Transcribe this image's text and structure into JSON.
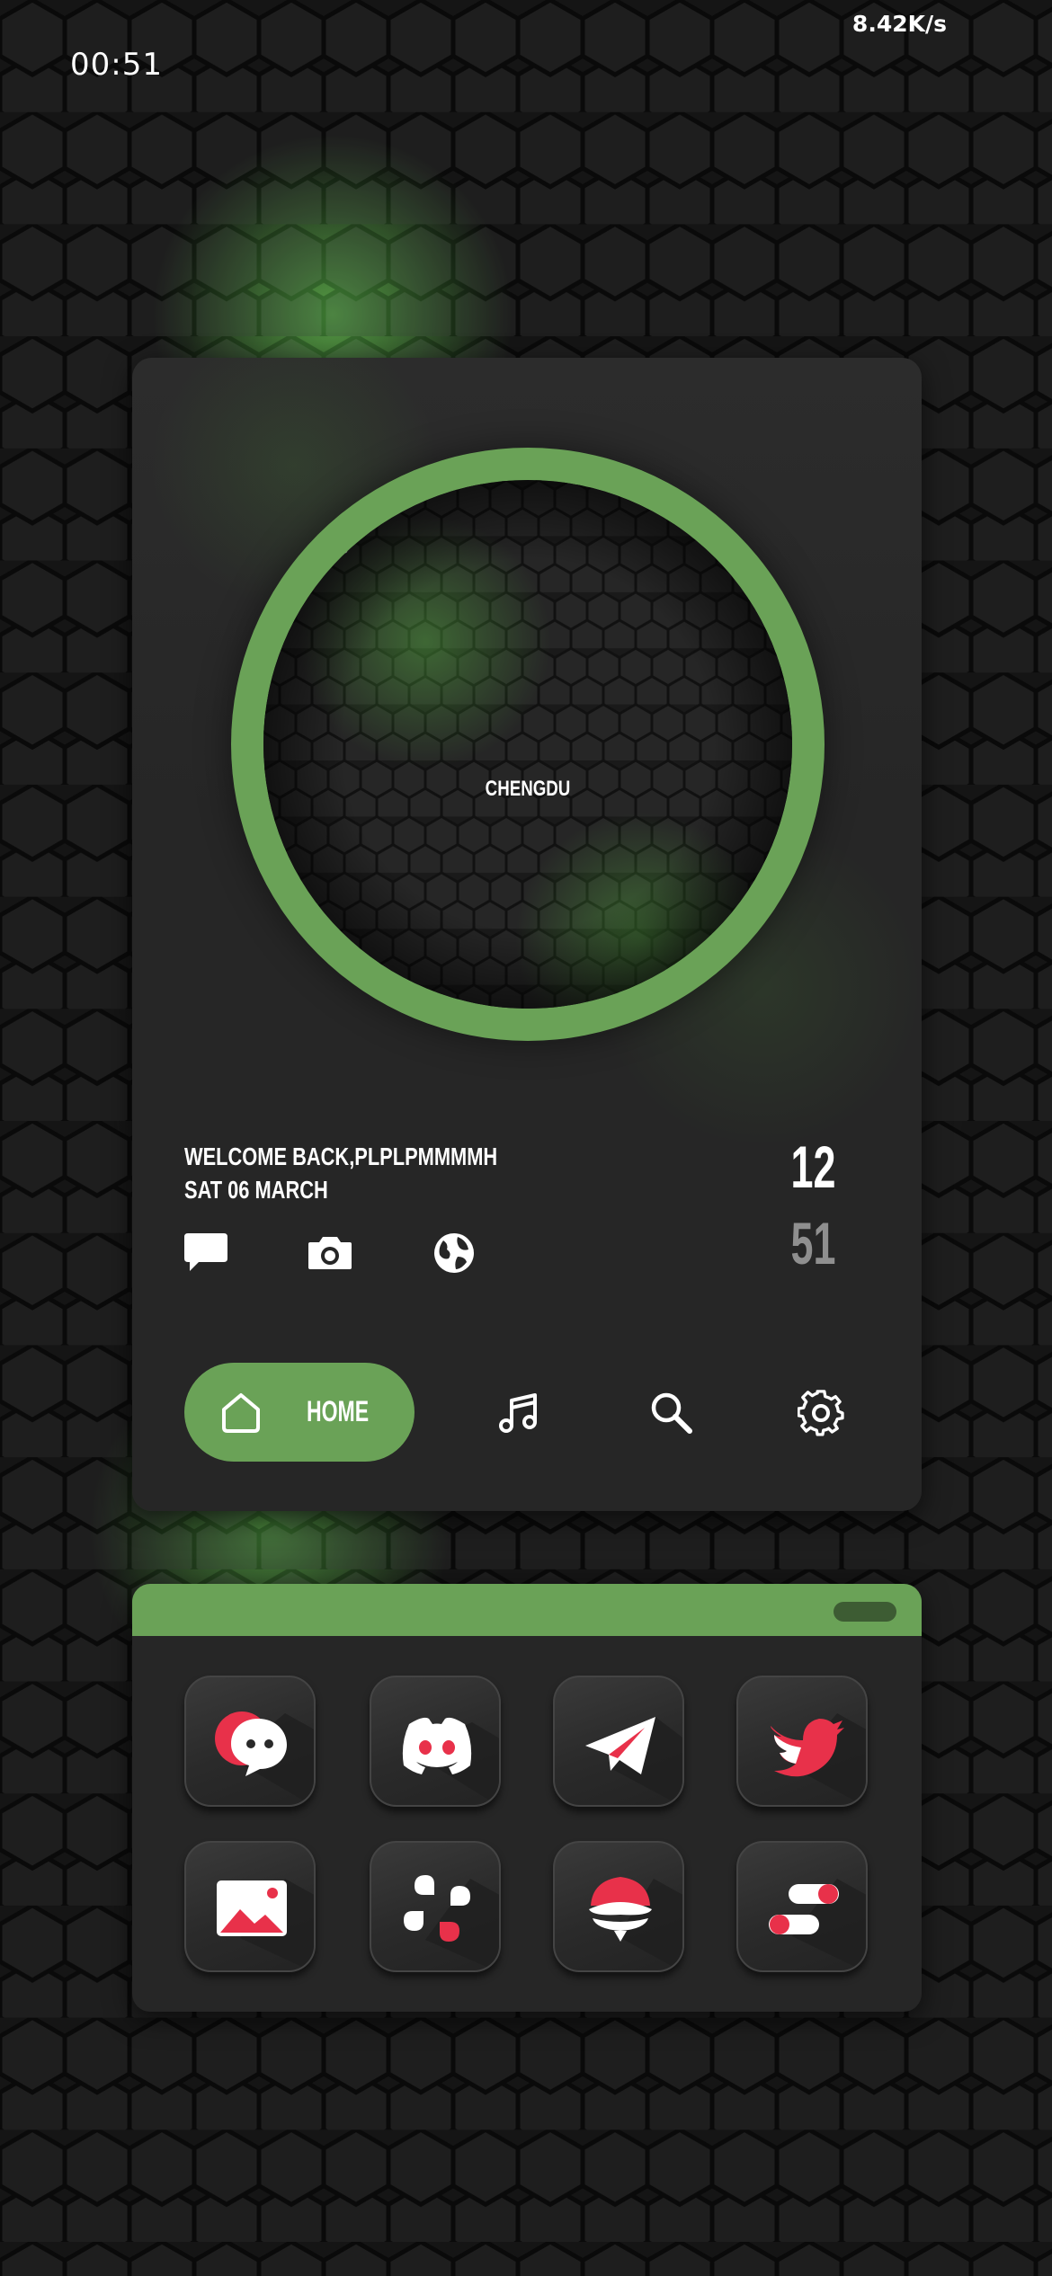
{
  "status_bar": {
    "time": "00:51",
    "net_speed": "8.42K/s"
  },
  "weather": {
    "city": "CHENGDU",
    "icon": "cloud-rain-icon"
  },
  "greeting": {
    "line1": "WELCOME BACK,PLPLPMMMMH",
    "line2": "SAT 06 MARCH"
  },
  "clock": {
    "hour": "12",
    "minute": "51"
  },
  "quick_actions": [
    {
      "icon": "chat-bubble-icon"
    },
    {
      "icon": "camera-icon"
    },
    {
      "icon": "globe-icon"
    }
  ],
  "nav": {
    "home_label": "HOME",
    "items": [
      {
        "icon": "home-icon"
      },
      {
        "icon": "music-note-icon"
      },
      {
        "icon": "search-icon"
      },
      {
        "icon": "gear-icon"
      }
    ]
  },
  "dock": {
    "apps": [
      {
        "icon": "chat-bubbles-icon"
      },
      {
        "icon": "discord-icon"
      },
      {
        "icon": "telegram-icon"
      },
      {
        "icon": "twitter-icon"
      },
      {
        "icon": "gallery-icon"
      },
      {
        "icon": "slack-icon"
      },
      {
        "icon": "layered-bubble-icon"
      },
      {
        "icon": "toggles-icon"
      }
    ]
  },
  "colors": {
    "accent_green": "#6aa257",
    "icon_red": "#e8314a",
    "card_bg": "#262626"
  }
}
